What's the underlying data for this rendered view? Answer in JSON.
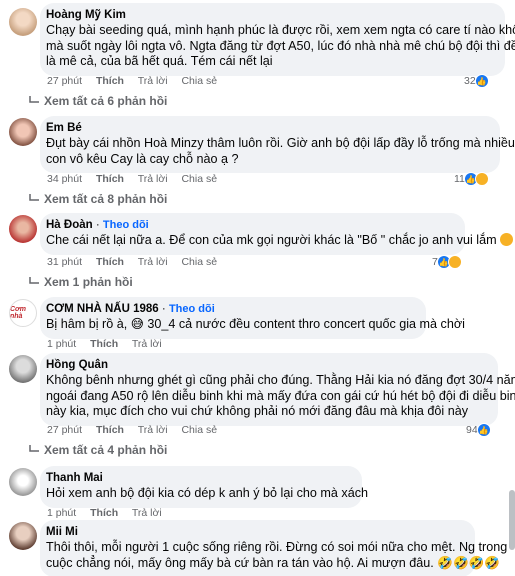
{
  "comments": [
    {
      "author": "Hoàng Mỹ Kim",
      "lines": [
        "Chạy bài seeding quá, mình hạnh phúc là được rồi, xem xem ngta có care tí nào không",
        "mà suốt ngày lôi ngta vô. Ngta đăng từ đợt A50, lúc đó nhà nhà mê chú bộ đội thì đều",
        "là mê cả, của bã hết quá. Tém cái nết lại"
      ],
      "time": "27 phút",
      "like": "Thích",
      "reply": "Trả lời",
      "share": "Chia sẻ",
      "reaction_count": "32",
      "view_more": "Xem tất cả 6 phản hồi"
    },
    {
      "author": "Em Bé",
      "lines": [
        "Đụt bày cái nhồn Hoà Minzy thâm luôn rồi. Giờ anh bộ đội lấp đầy lỗ trống mà nhiều",
        "con vô kêu Cay là cay chỗ nào ạ ?"
      ],
      "time": "34 phút",
      "like": "Thích",
      "reply": "Trả lời",
      "share": "Chia sẻ",
      "reaction_count": "11",
      "view_more": "Xem tất cả 8 phản hồi"
    },
    {
      "author": "Hà Đoàn",
      "follow": "Theo dõi",
      "lines": [
        "Che cái nết lại nữa a. Để con của mk gọi người khác là \"Bố \" chắc jo anh vui lắm"
      ],
      "time": "31 phút",
      "like": "Thích",
      "reply": "Trả lời",
      "share": "Chia sẻ",
      "reaction_count": "7",
      "view_more": "Xem 1 phản hồi"
    },
    {
      "author": "CƠM NHÀ NẤU 1986",
      "follow": "Theo dõi",
      "avatar_text": "Cơm nhà",
      "lines": [
        "Bị hâm bị rồ à, 😅 30_4 cả nước đều content thro concert quốc gia mà chời"
      ],
      "time": "1 phút",
      "like": "Thích",
      "reply": "Trả lời"
    },
    {
      "author": "Hồng Quân",
      "lines": [
        "Không bênh nhưng ghét gì cũng phải cho đúng. Thằng Hải kia nó đăng đợt 30/4 năm",
        "ngoái đang A50 rộ lên diễu binh khi mà mấy đứa con gái cứ hú hét bộ đội đi diễu binh",
        "này kia, mục đích cho vui chứ không phải nó mới đăng đâu mà khịa đôi này"
      ],
      "time": "27 phút",
      "like": "Thích",
      "reply": "Trả lời",
      "share": "Chia sẻ",
      "reaction_count": "94",
      "view_more": "Xem tất cả 4 phản hồi"
    },
    {
      "author": "Thanh Mai",
      "lines": [
        "Hỏi xem anh bộ đội kia có dép k anh ý bỏ lại cho mà xách"
      ],
      "time": "1 phút",
      "like": "Thích",
      "reply": "Trả lời"
    },
    {
      "author": "Mii Mi",
      "lines": [
        "Thôi thôi, mỗi người 1 cuộc sống riêng rồi. Đừng có soi mói nữa cho mệt. Ng trong",
        "cuộc chẳng nói, mấy ông mấy bà cứ bàn ra tán vào hộ. Ai mượn đâu. 🤣🤣🤣🤣"
      ]
    }
  ],
  "colors": {
    "bubble": "#f0f2f5",
    "meta": "#65676b",
    "follow": "#0866ff",
    "like": "#1877f2",
    "haha": "#f7b125"
  }
}
